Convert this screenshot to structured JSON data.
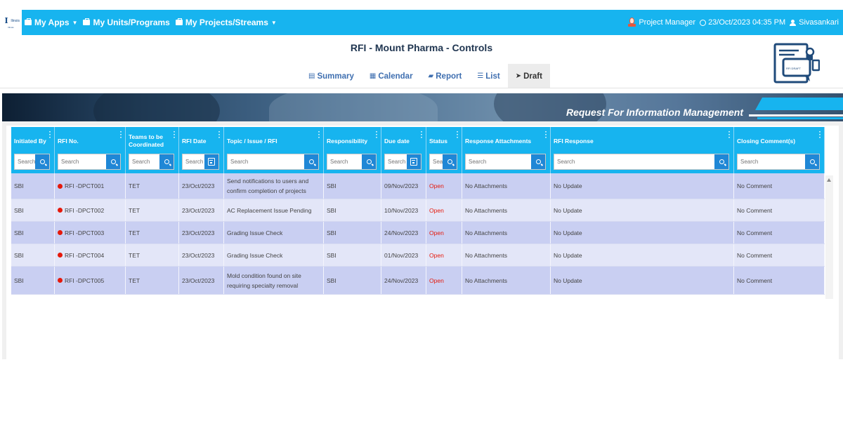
{
  "logo": {
    "text": "Illinois"
  },
  "nav": {
    "items": [
      {
        "label": "My Apps"
      },
      {
        "label": "My Units/Programs"
      },
      {
        "label": "My Projects/Streams"
      }
    ],
    "role": "Project Manager",
    "datetime": "23/Oct/2023 04:35 PM",
    "user": "Sivasankari"
  },
  "page": {
    "title": "RFI - Mount Pharma - Controls"
  },
  "tabs": [
    {
      "label": "Summary",
      "icon": "summary-icon"
    },
    {
      "label": "Calendar",
      "icon": "calendar-icon"
    },
    {
      "label": "Report",
      "icon": "report-icon"
    },
    {
      "label": "List",
      "icon": "list-icon"
    },
    {
      "label": "Draft",
      "icon": "paper-plane-icon",
      "active": true
    }
  ],
  "banner": {
    "title": "Request For Information Management"
  },
  "chat_icon": {
    "label": "RFI DRAFT"
  },
  "columns": [
    {
      "label": "Initiated By",
      "placeholder": "Search",
      "filter": "search"
    },
    {
      "label": "RFI No.",
      "placeholder": "Search",
      "filter": "search"
    },
    {
      "label": "Teams to be Coordinated",
      "placeholder": "Search",
      "filter": "search"
    },
    {
      "label": "RFI Date",
      "placeholder": "Search",
      "filter": "date"
    },
    {
      "label": "Topic / Issue / RFI",
      "placeholder": "Search",
      "filter": "search"
    },
    {
      "label": "Responsibility",
      "placeholder": "Search",
      "filter": "search"
    },
    {
      "label": "Due date",
      "placeholder": "Search",
      "filter": "date"
    },
    {
      "label": "Status",
      "placeholder": "Search",
      "filter": "search"
    },
    {
      "label": "Response Attachments",
      "placeholder": "Search",
      "filter": "search"
    },
    {
      "label": "RFI Response",
      "placeholder": "Search",
      "filter": "search"
    },
    {
      "label": "Closing Comment(s)",
      "placeholder": "Search",
      "filter": "search"
    }
  ],
  "rows": [
    [
      "SBI",
      "RFI -DPCT001",
      "TET",
      "23/Oct/2023",
      "Send notifications to users and confirm completion of projects",
      "SBI",
      "09/Nov/2023",
      "Open",
      "No Attachments",
      "No Update",
      "No Comment"
    ],
    [
      "SBI",
      "RFI -DPCT002",
      "TET",
      "23/Oct/2023",
      "AC Replacement Issue Pending",
      "SBI",
      "10/Nov/2023",
      "Open",
      "No Attachments",
      "No Update",
      "No Comment"
    ],
    [
      "SBI",
      "RFI -DPCT003",
      "TET",
      "23/Oct/2023",
      "Grading Issue Check",
      "SBI",
      "24/Nov/2023",
      "Open",
      "No Attachments",
      "No Update",
      "No Comment"
    ],
    [
      "SBI",
      "RFI -DPCT004",
      "TET",
      "23/Oct/2023",
      "Grading Issue Check",
      "SBI",
      "01/Nov/2023",
      "Open",
      "No Attachments",
      "No Update",
      "No Comment"
    ],
    [
      "SBI",
      "RFI -DPCT005",
      "TET",
      "23/Oct/2023",
      "Mold condition found on site requiring specialty removal",
      "SBI",
      "24/Nov/2023",
      "Open",
      "No Attachments",
      "No Update",
      "No Comment"
    ]
  ],
  "colors": {
    "nav": "#17b4ef",
    "row_odd": "#c9cff2",
    "row_even": "#e3e6f8",
    "status_open": "#e5190b"
  }
}
